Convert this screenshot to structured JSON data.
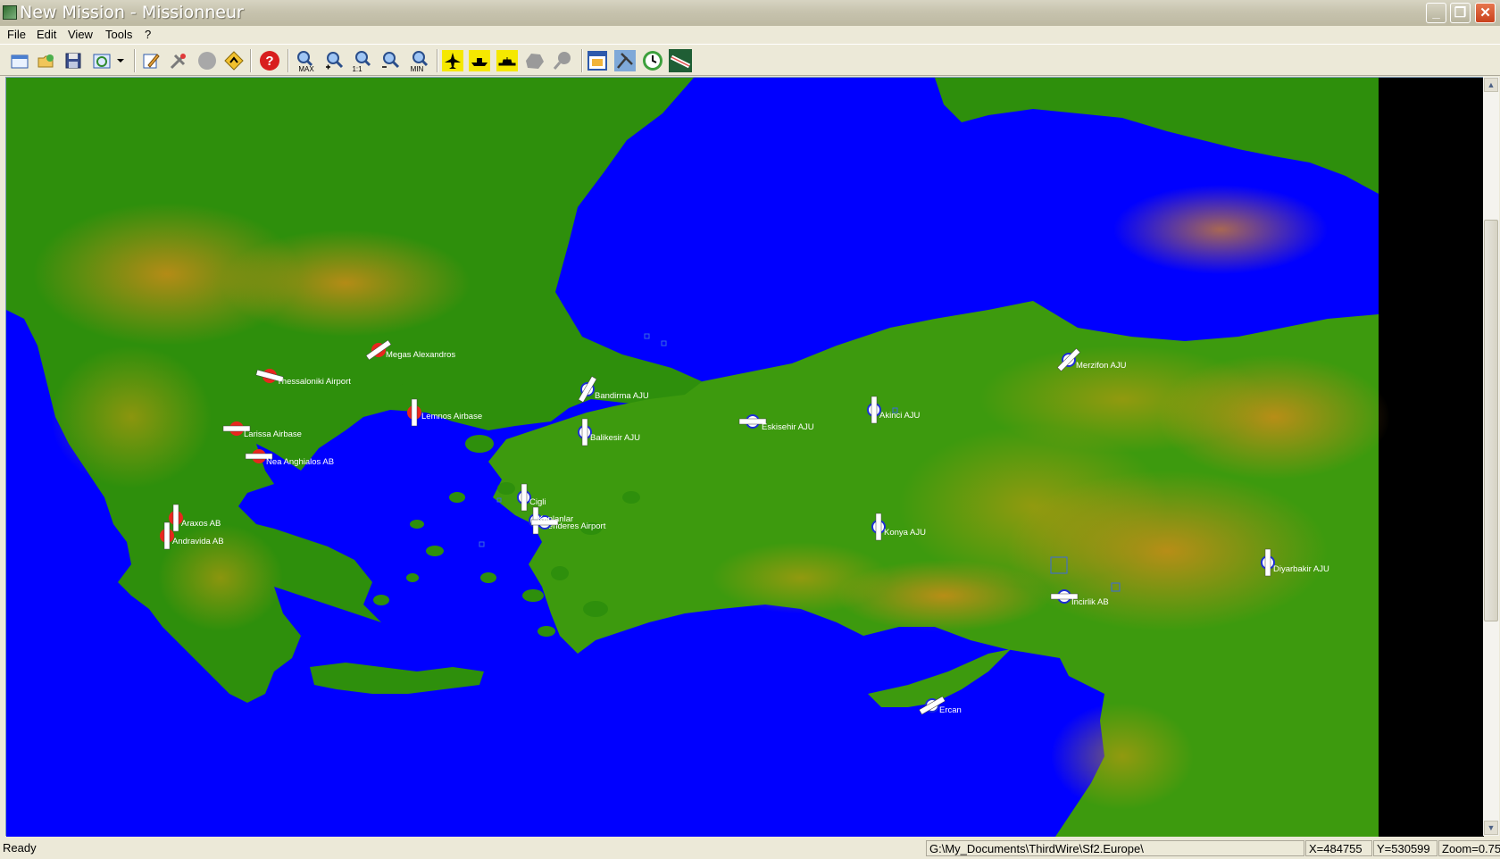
{
  "window": {
    "title": "New Mission - Missionneur"
  },
  "menu": [
    "File",
    "Edit",
    "View",
    "Tools",
    "?"
  ],
  "toolbar": {
    "icons": [
      "new-file-icon",
      "open-folder-icon",
      "save-disk-icon",
      "refresh-icon",
      "dropdown-arrow-icon",
      "edit-mission-icon",
      "settings-icon",
      "circle-icon",
      "waypoint-icon",
      "help-icon",
      "zoom-max-icon",
      "zoom-in-icon",
      "zoom-1-1-icon",
      "zoom-out-icon",
      "zoom-min-icon",
      "aircraft-icon",
      "ship-icon",
      "ground-unit-icon",
      "area-icon",
      "target-icon",
      "briefing-icon",
      "weather-icon",
      "clock-icon",
      "terrain-icon"
    ],
    "zoom_labels": {
      "max": "MAX",
      "one_to_one": "1:1",
      "min": "MIN"
    },
    "help_glyph": "?"
  },
  "map": {
    "colors": {
      "sea": "#0000FF",
      "red_force": "#E8271E",
      "blue_force": "#1E2FD6",
      "label": "#FFFFFF"
    },
    "airbases": [
      {
        "name": "Megas Alexandros",
        "side": "red"
      },
      {
        "name": "Thessaloniki Airport",
        "side": "red"
      },
      {
        "name": "Lemnos Airbase",
        "side": "red"
      },
      {
        "name": "Larissa Airbase",
        "side": "red"
      },
      {
        "name": "Nea Anghialos AB",
        "side": "red"
      },
      {
        "name": "Araxos AB",
        "side": "red"
      },
      {
        "name": "Andravida AB",
        "side": "red"
      },
      {
        "name": "Bandirma AJU",
        "side": "blue"
      },
      {
        "name": "Balikesir AJU",
        "side": "blue"
      },
      {
        "name": "Eskisehir AJU",
        "side": "blue"
      },
      {
        "name": "Akinci AJU",
        "side": "blue"
      },
      {
        "name": "Merzifon AJU",
        "side": "blue"
      },
      {
        "name": "Cigli",
        "side": "blue"
      },
      {
        "name": "Menderes Airport",
        "side": "blue"
      },
      {
        "name": "Kaplanlar",
        "side": "blue"
      },
      {
        "name": "Konya AJU",
        "side": "blue"
      },
      {
        "name": "Diyarbakir AJU",
        "side": "blue"
      },
      {
        "name": "Incirlik AB",
        "side": "blue"
      },
      {
        "name": "Ercan",
        "side": "blue"
      }
    ]
  },
  "status": {
    "ready": "Ready",
    "path": "G:\\My_Documents\\ThirdWire\\Sf2.Europe\\",
    "x": "X=484755",
    "y": "Y=530599",
    "zoom": "Zoom=0.75"
  }
}
